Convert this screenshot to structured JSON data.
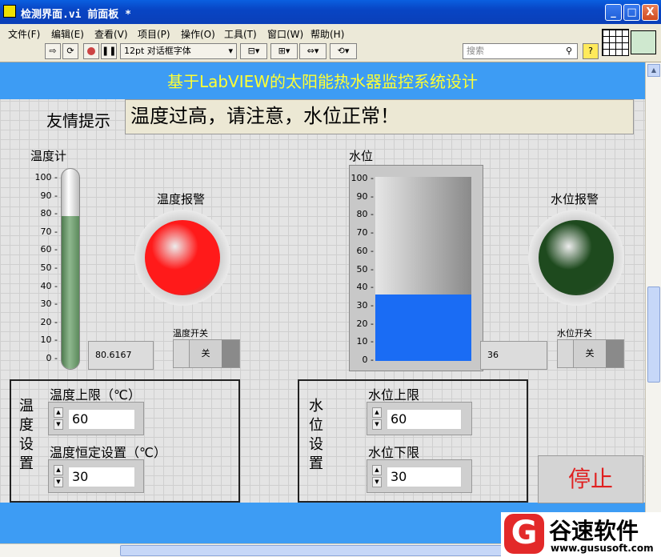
{
  "window": {
    "title": "检测界面.vi 前面板 *",
    "minimize": "_",
    "maximize": "□",
    "close": "X"
  },
  "menu": [
    "文件(F)",
    "编辑(E)",
    "查看(V)",
    "项目(P)",
    "操作(O)",
    "工具(T)",
    "窗口(W)",
    "帮助(H)"
  ],
  "toolbar": {
    "font": "12pt 对话框字体",
    "search_placeholder": "搜索",
    "help": "?"
  },
  "banner": "基于LabVIEW的太阳能热水器监控系统设计",
  "tip": {
    "label": "友情提示",
    "message": "温度过高，请注意，水位正常！"
  },
  "thermometer": {
    "label": "温度计",
    "ticks": [
      "100",
      "90",
      "80",
      "70",
      "60",
      "50",
      "40",
      "30",
      "20",
      "10",
      "0"
    ],
    "value": 80.6167,
    "display": "80.6167"
  },
  "temp_alarm": {
    "label": "温度报警",
    "color": "#ff1a1a",
    "state": "on"
  },
  "temp_switch": {
    "label": "温度开关",
    "text": "关"
  },
  "tank": {
    "label": "水位",
    "ticks": [
      "100",
      "90",
      "80",
      "70",
      "60",
      "50",
      "40",
      "30",
      "20",
      "10",
      "0"
    ],
    "value": 36,
    "display": "36"
  },
  "water_alarm": {
    "label": "水位报警",
    "color": "#1e4a1e",
    "state": "off"
  },
  "water_switch": {
    "label": "水位开关",
    "text": "关"
  },
  "temp_group": {
    "title": "温度设置",
    "upper": {
      "label": "温度上限（℃）",
      "value": "60"
    },
    "constant": {
      "label": "温度恒定设置（℃）",
      "value": "30"
    }
  },
  "water_group": {
    "title": "水位设置",
    "upper": {
      "label": "水位上限",
      "value": "60"
    },
    "lower": {
      "label": "水位下限",
      "value": "30"
    }
  },
  "stop": "停止",
  "watermark": {
    "letter": "G",
    "name": "谷速软件",
    "url": "www.gususoft.com"
  }
}
